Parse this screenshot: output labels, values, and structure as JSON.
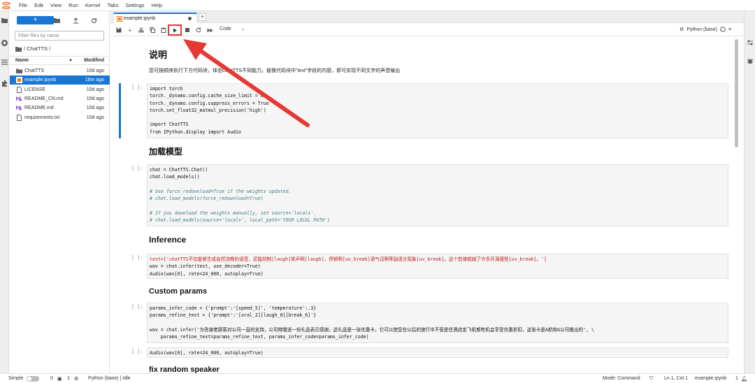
{
  "menubar": {
    "items": [
      "File",
      "Edit",
      "View",
      "Run",
      "Kernel",
      "Tabs",
      "Settings",
      "Help"
    ]
  },
  "filebrowser": {
    "new_label": "+",
    "filter_placeholder": "Filter files by name",
    "breadcrumb": "/ ChatTTS /",
    "col_name": "Name",
    "col_modified": "Modified",
    "files": [
      {
        "name": "ChatTTS",
        "modified": "10d ago",
        "icon": "folder-icon",
        "selected": false
      },
      {
        "name": "example.ipynb",
        "modified": "18m ago",
        "icon": "notebook-icon",
        "selected": true
      },
      {
        "name": "LICENSE",
        "modified": "10d ago",
        "icon": "file-icon",
        "selected": false
      },
      {
        "name": "README_CN.md",
        "modified": "10d ago",
        "icon": "markdown-icon",
        "selected": false
      },
      {
        "name": "README.md",
        "modified": "10d ago",
        "icon": "markdown-icon",
        "selected": false
      },
      {
        "name": "requirements.txt",
        "modified": "10d ago",
        "icon": "file-icon",
        "selected": false
      }
    ]
  },
  "tabs": {
    "active_label": "example.ipynb",
    "add_label": "+"
  },
  "toolbar": {
    "cell_type": "Code",
    "kernel": "Python (base)"
  },
  "notebook": {
    "h_intro": "说明",
    "p_intro": "您可按顺序执行下方代码块，体验ChatTTS不同能力。替换代码块中\"text\"字段的内容，即可实现不同文字的声音输出",
    "h_load": "加载模型",
    "h_inference": "Inference",
    "h_custom": "Custom params",
    "h_fix": "fix random speaker",
    "prompt": "[ ]:",
    "cell1": [
      "import torch",
      "torch._dynamo.config.cache_size_limit = 64",
      "torch._dynamo.config.suppress_errors = True",
      "torch.set_float32_matmul_precision('high')",
      "",
      "import ChatTTS",
      "from IPython.display import Audio"
    ],
    "cell2": [
      "chat = ChatTTS.Chat()",
      "chat.load_models()",
      "",
      "# Use force_redownload=True if the weights updated.",
      "# chat.load_models(force_redownload=True)",
      "",
      "# If you download the weights manually, set source='locals'.",
      "# chat.load_models(source='locals', local_path='YOUR LOCAL PATH')"
    ],
    "cell3": [
      "text=['chatTTS不仅能够生成自然流畅的语音，还能控制[laugh]笑声啊[laugh]，停顿啊[uv_break]语气词啊等副语言现象[uv_break]。这个韵律超越了许多开源模型[uv_break]。']",
      "wav = chat.infer(text, use_decoder=True)",
      "Audio(wav[0], rate=24_000, autoplay=True)"
    ],
    "cell4": [
      "params_infer_code = {'prompt':'[speed_5]', 'temperature':.3}",
      "params_refine_text = {'prompt':'[oral_2][laugh_0][break_6]'}",
      "",
      "wav = chat.infer('为答谢老顾客对公司一直的支持，公司特赠送一份礼品表示感谢，这礼品是一张优惠卡，它可以使您在以后的旅行中不管是住酒店坐飞机都有机会享受优惠折扣，这张卡是A航和G公司推出的', \\",
      "    params_refine_text=params_refine_text, params_infer_code=params_infer_code)"
    ],
    "cell5": [
      "Audio(wav[0], rate=24_000, autoplay=True)"
    ]
  },
  "statusbar": {
    "mode_label": "Simple",
    "count_a": "0",
    "count_b": "1",
    "kernel_status": "Python (base) | Idle",
    "mode": "Mode: Command",
    "position": "Ln 1, Col 1",
    "filename": "example.ipynb",
    "notif_count": "1"
  },
  "colors": {
    "accent": "#1976d2",
    "highlight": "#e53935"
  }
}
